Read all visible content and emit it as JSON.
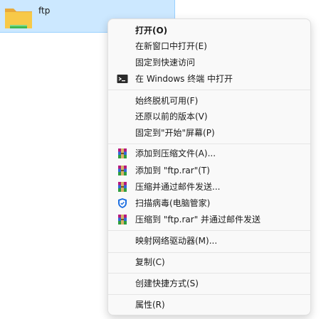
{
  "file": {
    "name": "ftp",
    "icon": "folder-icon"
  },
  "menu": {
    "items": [
      {
        "label": "打开(O)",
        "icon": ""
      },
      {
        "label": "在新窗口中打开(E)",
        "icon": ""
      },
      {
        "label": "固定到快速访问",
        "icon": ""
      },
      {
        "label": "在 Windows 终端 中打开",
        "icon": "terminal-icon"
      },
      {
        "label": "始终脱机可用(F)",
        "icon": ""
      },
      {
        "label": "还原以前的版本(V)",
        "icon": ""
      },
      {
        "label": "固定到\"开始\"屏幕(P)",
        "icon": ""
      },
      {
        "label": "添加到压缩文件(A)...",
        "icon": "winrar-icon"
      },
      {
        "label": "添加到 \"ftp.rar\"(T)",
        "icon": "winrar-icon"
      },
      {
        "label": "压缩并通过邮件发送...",
        "icon": "winrar-icon"
      },
      {
        "label": "扫描病毒(电脑管家)",
        "icon": "shield-icon"
      },
      {
        "label": "压缩到 \"ftp.rar\" 并通过邮件发送",
        "icon": "winrar-icon"
      },
      {
        "label": "映射网络驱动器(M)...",
        "icon": ""
      },
      {
        "label": "复制(C)",
        "icon": ""
      },
      {
        "label": "创建快捷方式(S)",
        "icon": ""
      },
      {
        "label": "属性(R)",
        "icon": ""
      }
    ]
  },
  "colors": {
    "selection": "#cce8ff",
    "menu_bg": "#f9f9f9",
    "shield": "#1e6fe0"
  }
}
